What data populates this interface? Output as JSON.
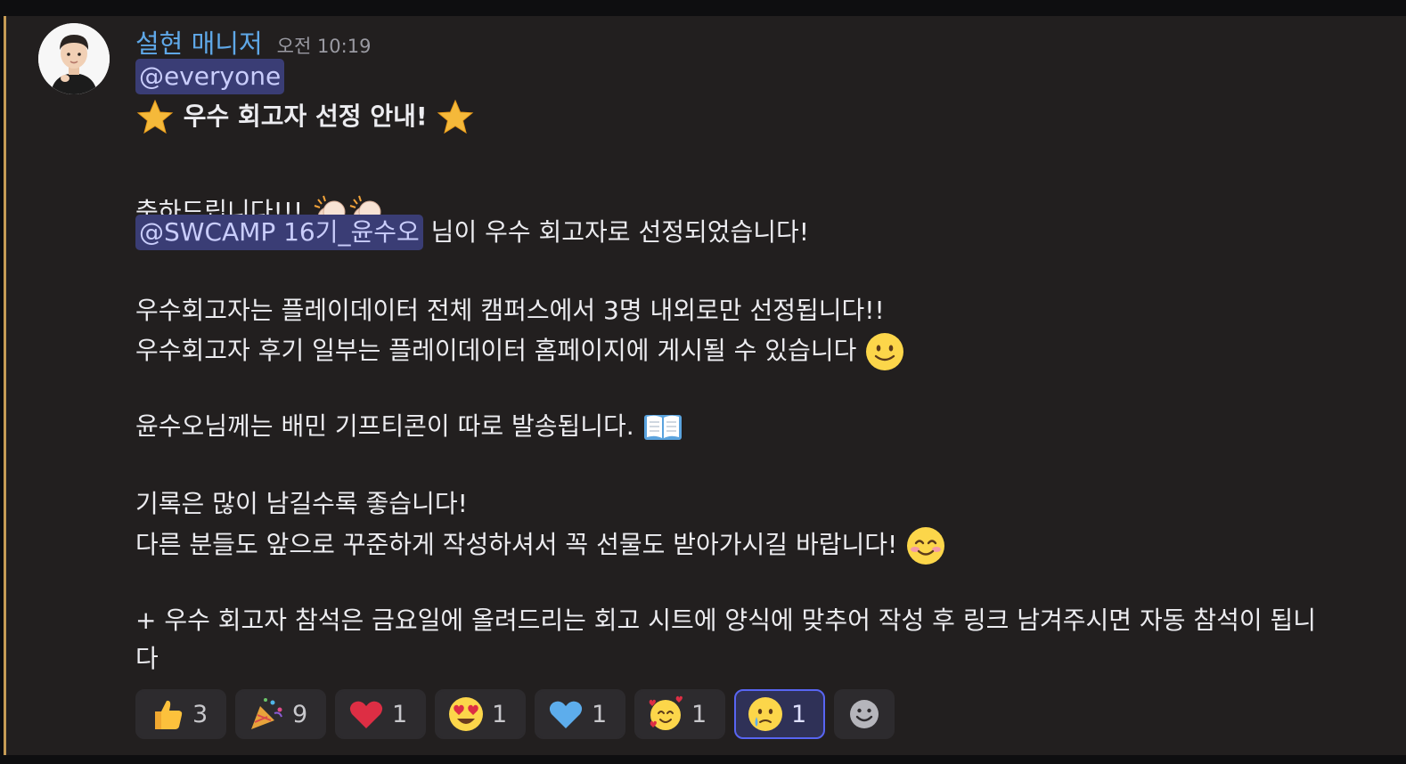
{
  "message": {
    "author": "설현 매니저",
    "timestamp": "오전 10:19",
    "mention_everyone": "@everyone",
    "title_line": "우수 회고자 선정 안내!",
    "congrats": "축하드립니다!!!",
    "mention_user": "@SWCAMP 16기_윤수오",
    "selected_text": " 님이 우수 회고자로 선정되었습니다!",
    "line_campus": "우수회고자는 플레이데이터 전체 캠퍼스에서 3명 내외로만 선정됩니다!!",
    "line_review": "우수회고자 후기 일부는 플레이데이터 홈페이지에 게시될 수 있습니다",
    "line_gift": "윤수오님께는 배민 기프티콘이 따로 발송됩니다.",
    "line_record": "기록은 많이 남길수록 좋습니다!",
    "line_others": "다른 분들도 앞으로 꾸준하게 작성하셔서 꼭 선물도 받아가시길 바랍니다!",
    "line_attendance": "+ 우수 회고자 참석은 금요일에 올려드리는 회고 시트에 양식에 맞추어 작성 후 링크 남겨주시면 자동 참석이 됩니",
    "line_attendance_wrap": "다"
  },
  "reactions": [
    {
      "emoji": "thumbs-up",
      "count": "3",
      "active": false
    },
    {
      "emoji": "party-popper",
      "count": "9",
      "active": false
    },
    {
      "emoji": "red-heart",
      "count": "1",
      "active": false
    },
    {
      "emoji": "heart-eyes",
      "count": "1",
      "active": false
    },
    {
      "emoji": "blue-heart",
      "count": "1",
      "active": false
    },
    {
      "emoji": "smiling-with-hearts",
      "count": "1",
      "active": false
    },
    {
      "emoji": "crying-face",
      "count": "1",
      "active": true
    }
  ],
  "colors": {
    "author": "#5fa8e8",
    "mention_bg": "#3a3d75",
    "mention_text": "#c9cdfb",
    "message_bg": "#221f1f",
    "highlight_bar": "#c59b55",
    "active_reaction_border": "#5865f2"
  }
}
